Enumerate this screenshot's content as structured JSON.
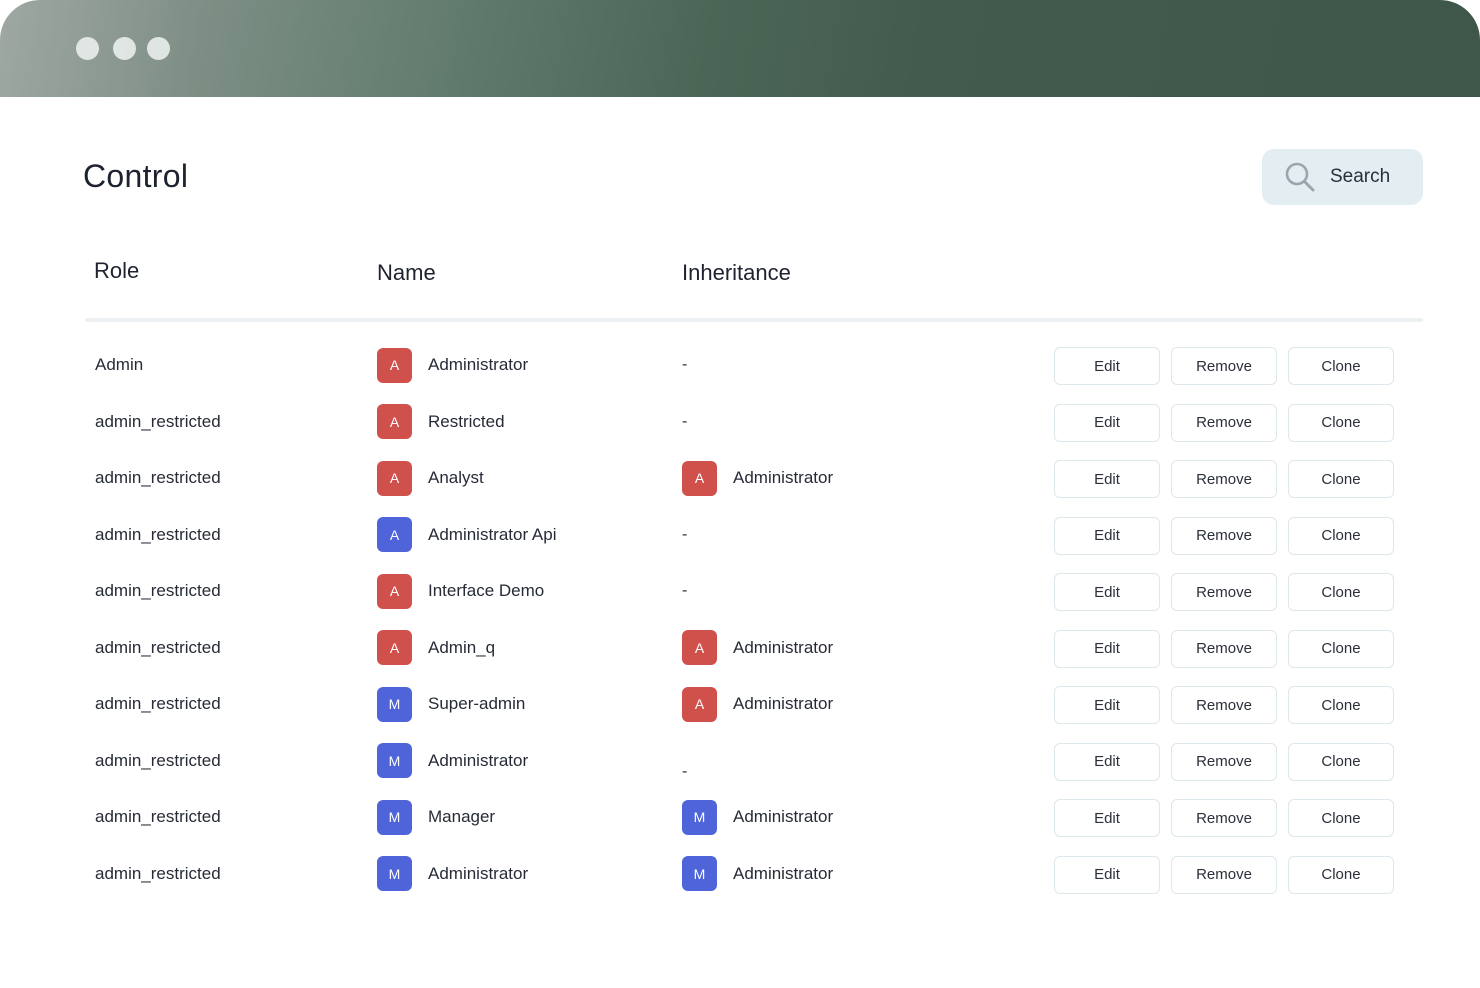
{
  "window": {
    "controls": [
      "window-dot-1",
      "window-dot-2",
      "window-dot-3"
    ]
  },
  "page": {
    "title": "Control"
  },
  "search": {
    "label": "Search",
    "icon": "search-icon"
  },
  "columns": {
    "role": "Role",
    "name": "Name",
    "inheritance": "Inheritance"
  },
  "actions": {
    "edit": "Edit",
    "remove": "Remove",
    "clone": "Clone"
  },
  "colors": {
    "avatar_red": "#d0514b",
    "avatar_blue": "#4f64d9",
    "search_bg": "#e4edf1"
  },
  "rows": [
    {
      "role": "Admin",
      "name": {
        "initial": "A",
        "color": "red",
        "label": "Administrator"
      },
      "inheritance": {
        "none": "-"
      }
    },
    {
      "role": "admin_restricted",
      "name": {
        "initial": "A",
        "color": "red",
        "label": "Restricted"
      },
      "inheritance": {
        "none": "-"
      }
    },
    {
      "role": "admin_restricted",
      "name": {
        "initial": "A",
        "color": "red",
        "label": "Analyst"
      },
      "inheritance": {
        "initial": "A",
        "color": "red",
        "label": "Administrator"
      }
    },
    {
      "role": "admin_restricted",
      "name": {
        "initial": "A",
        "color": "blue",
        "label": "Administrator Api"
      },
      "inheritance": {
        "none": "-"
      }
    },
    {
      "role": "admin_restricted",
      "name": {
        "initial": "A",
        "color": "red",
        "label": "Interface Demo"
      },
      "inheritance": {
        "none": "-"
      }
    },
    {
      "role": "admin_restricted",
      "name": {
        "initial": "A",
        "color": "red",
        "label": "Admin_q"
      },
      "inheritance": {
        "initial": "A",
        "color": "red",
        "label": "Administrator"
      }
    },
    {
      "role": "admin_restricted",
      "name": {
        "initial": "M",
        "color": "blue",
        "label": "Super-admin"
      },
      "inheritance": {
        "initial": "A",
        "color": "red",
        "label": "Administrator"
      }
    },
    {
      "role": "admin_restricted",
      "name": {
        "initial": "M",
        "color": "blue",
        "label": "Administrator"
      },
      "inheritance": {
        "none": "-",
        "low": true
      }
    },
    {
      "role": "admin_restricted",
      "name": {
        "initial": "M",
        "color": "blue",
        "label": "Manager"
      },
      "inheritance": {
        "initial": "M",
        "color": "blue",
        "label": "Administrator"
      }
    },
    {
      "role": "admin_restricted",
      "name": {
        "initial": "M",
        "color": "blue",
        "label": "Administrator"
      },
      "inheritance": {
        "initial": "M",
        "color": "blue",
        "label": "Administrator"
      }
    }
  ]
}
